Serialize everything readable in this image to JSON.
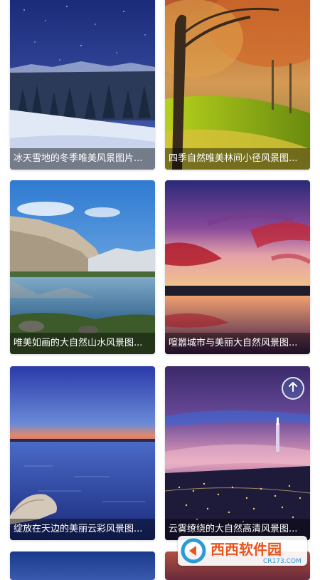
{
  "gallery": {
    "items": [
      {
        "caption": "冰天雪地的冬季唯美风景图片..."
      },
      {
        "caption": "四季自然唯美林间小径风景图..."
      },
      {
        "caption": "唯美如画的大自然山水风景图..."
      },
      {
        "caption": "喧嚣城市与美丽大自然风景图..."
      },
      {
        "caption": "绽放在天边的美丽云彩风景图..."
      },
      {
        "caption": "云雾缭绕的大自然高清风景图..."
      }
    ]
  },
  "scroll_top": {
    "icon": "arrow-up-icon"
  },
  "watermark": {
    "brand_text": "西西软件园",
    "url_text": "CR173.COM"
  },
  "colors": {
    "caption_bg": "rgba(0,0,0,0.42)",
    "caption_text": "#ffffff",
    "watermark_accent": "#e8541e"
  }
}
